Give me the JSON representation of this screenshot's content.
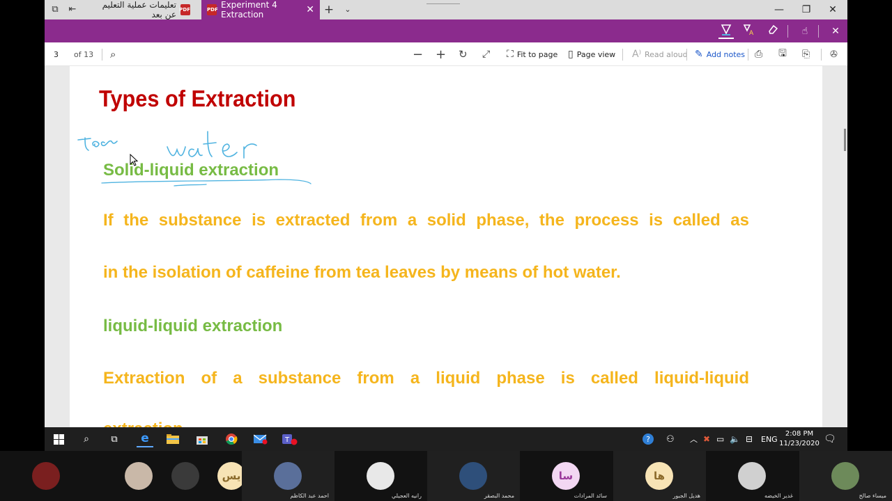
{
  "tabs": [
    {
      "title": "تعليمات عملية التعليم عن بعد",
      "active": false
    },
    {
      "title": "Experiment 4 Extraction",
      "active": true
    }
  ],
  "pdf_toolbar": {
    "page_number": "3",
    "page_total": "of 13",
    "fit_to_page": "Fit to page",
    "page_view": "Page view",
    "read_aloud": "Read aloud",
    "add_notes": "Add notes"
  },
  "document": {
    "title": "Types of Extraction",
    "handwriting": [
      "tea",
      "water"
    ],
    "heading1": "Solid-liquid extraction",
    "para1_line1": "If the substance is extracted from a solid phase, the process is called as",
    "para1_line2": "in the isolation of caffeine from tea leaves by means of hot water.",
    "heading2": "liquid-liquid extraction",
    "para2_line1": "Extraction of a substance from a liquid phase is called liquid-liquid",
    "para2_line2": "extraction"
  },
  "taskbar": {
    "language": "ENG",
    "time": "2:08 PM",
    "date": "11/23/2020",
    "teams_badge": "2",
    "notification_count": "7"
  },
  "participants": [
    {
      "name": "",
      "initials": "",
      "color": "#7a1f1f"
    },
    {
      "name": "",
      "initials": "",
      "color": "#c9b8a8"
    },
    {
      "name": "",
      "initials": "",
      "color": "#3a3a3a"
    },
    {
      "name": "",
      "initials": "يس",
      "color": "#f7e3b5"
    },
    {
      "name": "احمد عبد الكاظم",
      "initials": "",
      "color": "#5a6f9a"
    },
    {
      "name": "رانيه العجيلي",
      "initials": "",
      "color": "#e8e8e8"
    },
    {
      "name": "محمد البصقر",
      "initials": "",
      "color": "#2e4f7a"
    },
    {
      "name": "سائد المرادات",
      "initials": "سا",
      "color": "#f2d7f2"
    },
    {
      "name": "هديل الجبور",
      "initials": "ها",
      "color": "#f7e3b5"
    },
    {
      "name": "غدير الخيضه",
      "initials": "",
      "color": "#d0d0d0"
    },
    {
      "name": "ميساء صالح",
      "initials": "",
      "color": "#6d8a5a"
    }
  ],
  "colors": {
    "accent": "#8b2b8d",
    "title_red": "#c00000",
    "heading_green": "#77bb44",
    "body_orange": "#f5b51d",
    "ink_blue": "#4fb3e0"
  }
}
